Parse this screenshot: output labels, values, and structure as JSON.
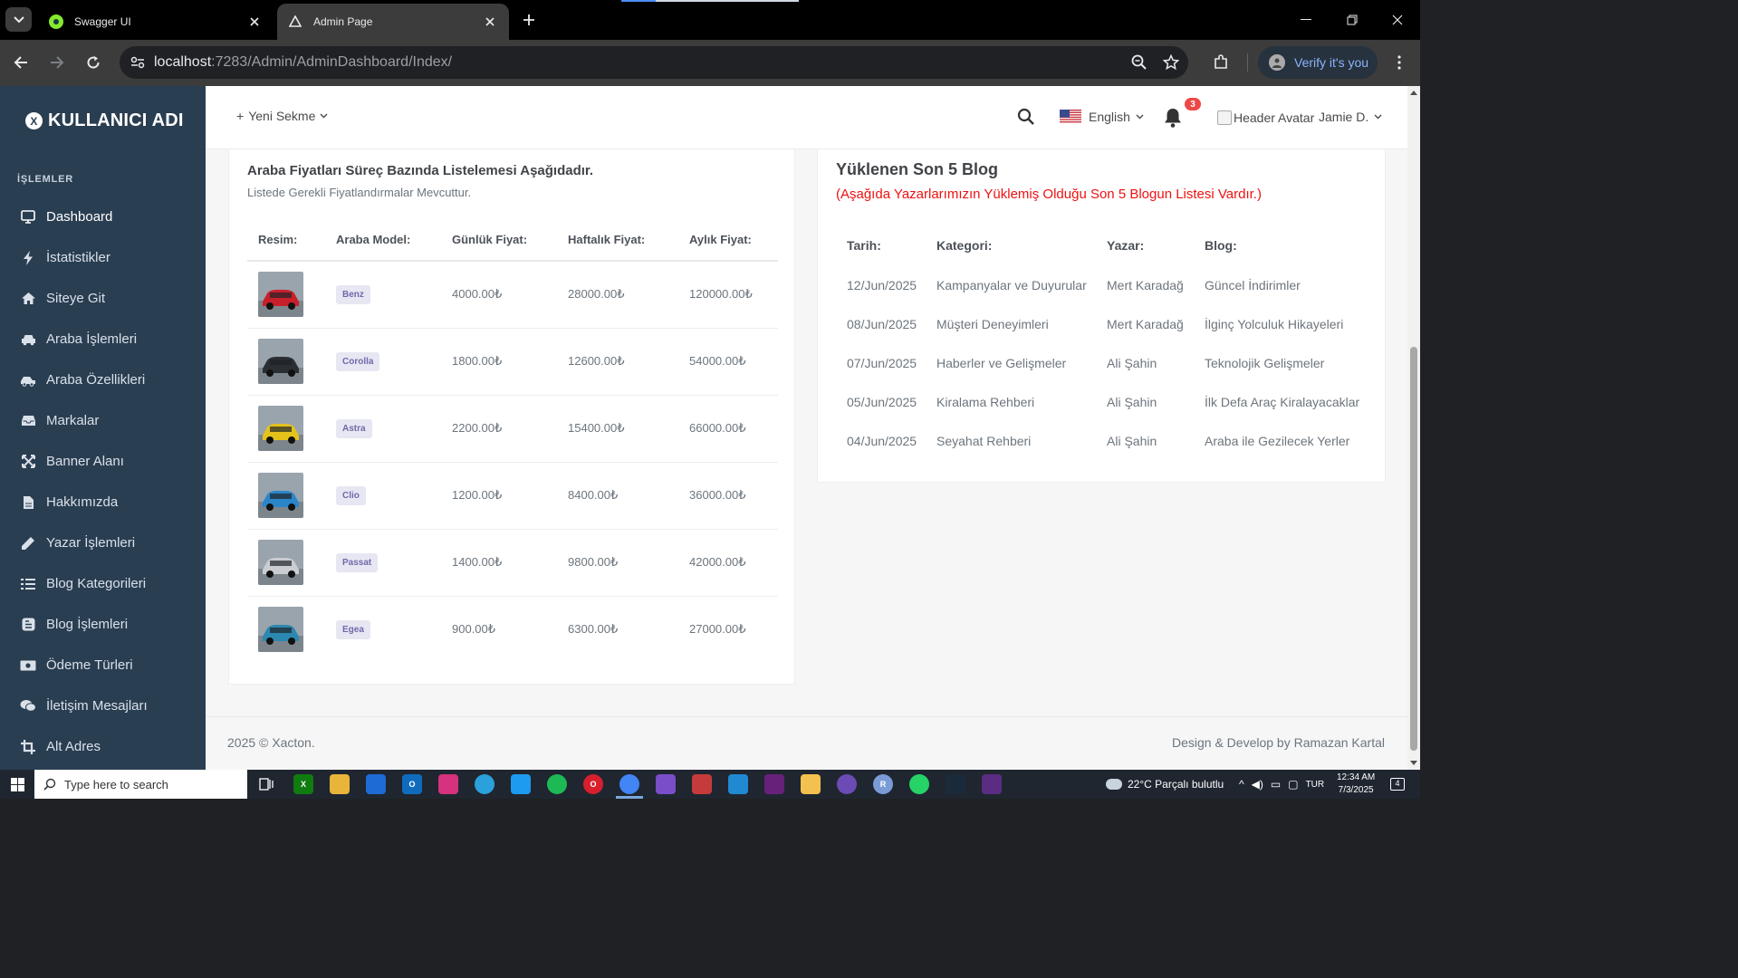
{
  "browser": {
    "tabs": [
      {
        "title": "Swagger UI",
        "active": false
      },
      {
        "title": "Admin Page",
        "active": true
      }
    ],
    "url_host": "localhost",
    "url_path": ":7283/Admin/AdminDashboard/Index/",
    "verify_label": "Verify it's you"
  },
  "sidebar": {
    "brand": "KULLANICI ADI",
    "section_title": "İŞLEMLER",
    "items": [
      {
        "label": "Dashboard",
        "icon": "monitor-icon",
        "active": true
      },
      {
        "label": "İstatistikler",
        "icon": "bolt-icon"
      },
      {
        "label": "Siteye Git",
        "icon": "home-icon"
      },
      {
        "label": "Araba İşlemleri",
        "icon": "car-icon"
      },
      {
        "label": "Araba Özellikleri",
        "icon": "car-side-icon"
      },
      {
        "label": "Markalar",
        "icon": "inbox-icon"
      },
      {
        "label": "Banner Alanı",
        "icon": "expand-icon"
      },
      {
        "label": "Hakkımızda",
        "icon": "file-icon"
      },
      {
        "label": "Yazar İşlemleri",
        "icon": "pen-icon"
      },
      {
        "label": "Blog Kategorileri",
        "icon": "list-icon"
      },
      {
        "label": "Blog İşlemleri",
        "icon": "blogger-icon"
      },
      {
        "label": "Ödeme Türleri",
        "icon": "money-icon"
      },
      {
        "label": "İletişim Mesajları",
        "icon": "comments-icon"
      },
      {
        "label": "Alt Adres",
        "icon": "crop-icon"
      }
    ]
  },
  "header": {
    "new_tab_label": "Yeni Sekme",
    "language": "English",
    "notification_count": "3",
    "avatar_alt": "Header Avatar",
    "user_name": "Jamie D."
  },
  "car_prices": {
    "title": "Araba Fiyatları Süreç Bazında Listelemesi Aşağıdadır.",
    "subtitle": "Listede Gerekli Fiyatlandırmalar Mevcuttur.",
    "columns": [
      "Resim:",
      "Araba Model:",
      "Günlük Fiyat:",
      "Haftalık Fiyat:",
      "Aylık Fiyat:"
    ],
    "rows": [
      {
        "model": "Benz",
        "daily": "4000.00₺",
        "weekly": "28000.00₺",
        "monthly": "120000.00₺",
        "color": "#c8202b"
      },
      {
        "model": "Corolla",
        "daily": "1800.00₺",
        "weekly": "12600.00₺",
        "monthly": "54000.00₺",
        "color": "#2b2e33"
      },
      {
        "model": "Astra",
        "daily": "2200.00₺",
        "weekly": "15400.00₺",
        "monthly": "66000.00₺",
        "color": "#e4c21b"
      },
      {
        "model": "Clio",
        "daily": "1200.00₺",
        "weekly": "8400.00₺",
        "monthly": "36000.00₺",
        "color": "#2a86c9"
      },
      {
        "model": "Passat",
        "daily": "1400.00₺",
        "weekly": "9800.00₺",
        "monthly": "42000.00₺",
        "color": "#c9ccd1"
      },
      {
        "model": "Egea",
        "daily": "900.00₺",
        "weekly": "6300.00₺",
        "monthly": "27000.00₺",
        "color": "#2c88b0"
      }
    ]
  },
  "latest_blogs": {
    "title": "Yüklenen Son 5 Blog",
    "subtitle": "(Aşağıda Yazarlarımızın Yüklemiş Olduğu Son 5 Blogun Listesi Vardır.)",
    "columns": [
      "Tarih:",
      "Kategori:",
      "Yazar:",
      "Blog:"
    ],
    "rows": [
      {
        "date": "12/Jun/2025",
        "category": "Kampanyalar ve Duyurular",
        "author": "Mert Karadağ",
        "blog": "Güncel İndirimler"
      },
      {
        "date": "08/Jun/2025",
        "category": "Müşteri Deneyimleri",
        "author": "Mert Karadağ",
        "blog": "İlginç Yolculuk Hikayeleri"
      },
      {
        "date": "07/Jun/2025",
        "category": "Haberler ve Gelişmeler",
        "author": "Ali Şahin",
        "blog": "Teknolojik Gelişmeler"
      },
      {
        "date": "05/Jun/2025",
        "category": "Kiralama Rehberi",
        "author": "Ali Şahin",
        "blog": "İlk Defa Araç Kiralayacaklar"
      },
      {
        "date": "04/Jun/2025",
        "category": "Seyahat Rehberi",
        "author": "Ali Şahin",
        "blog": "Araba ile Gezilecek Yerler"
      }
    ]
  },
  "footer": {
    "left": "2025 © Xacton.",
    "right": "Design & Develop by Ramazan Kartal"
  },
  "taskbar": {
    "search_placeholder": "Type here to search",
    "weather": "22°C  Parçalı bulutlu",
    "lang": "TUR",
    "time": "12:34 AM",
    "date": "7/3/2025",
    "notif_count": "4"
  }
}
